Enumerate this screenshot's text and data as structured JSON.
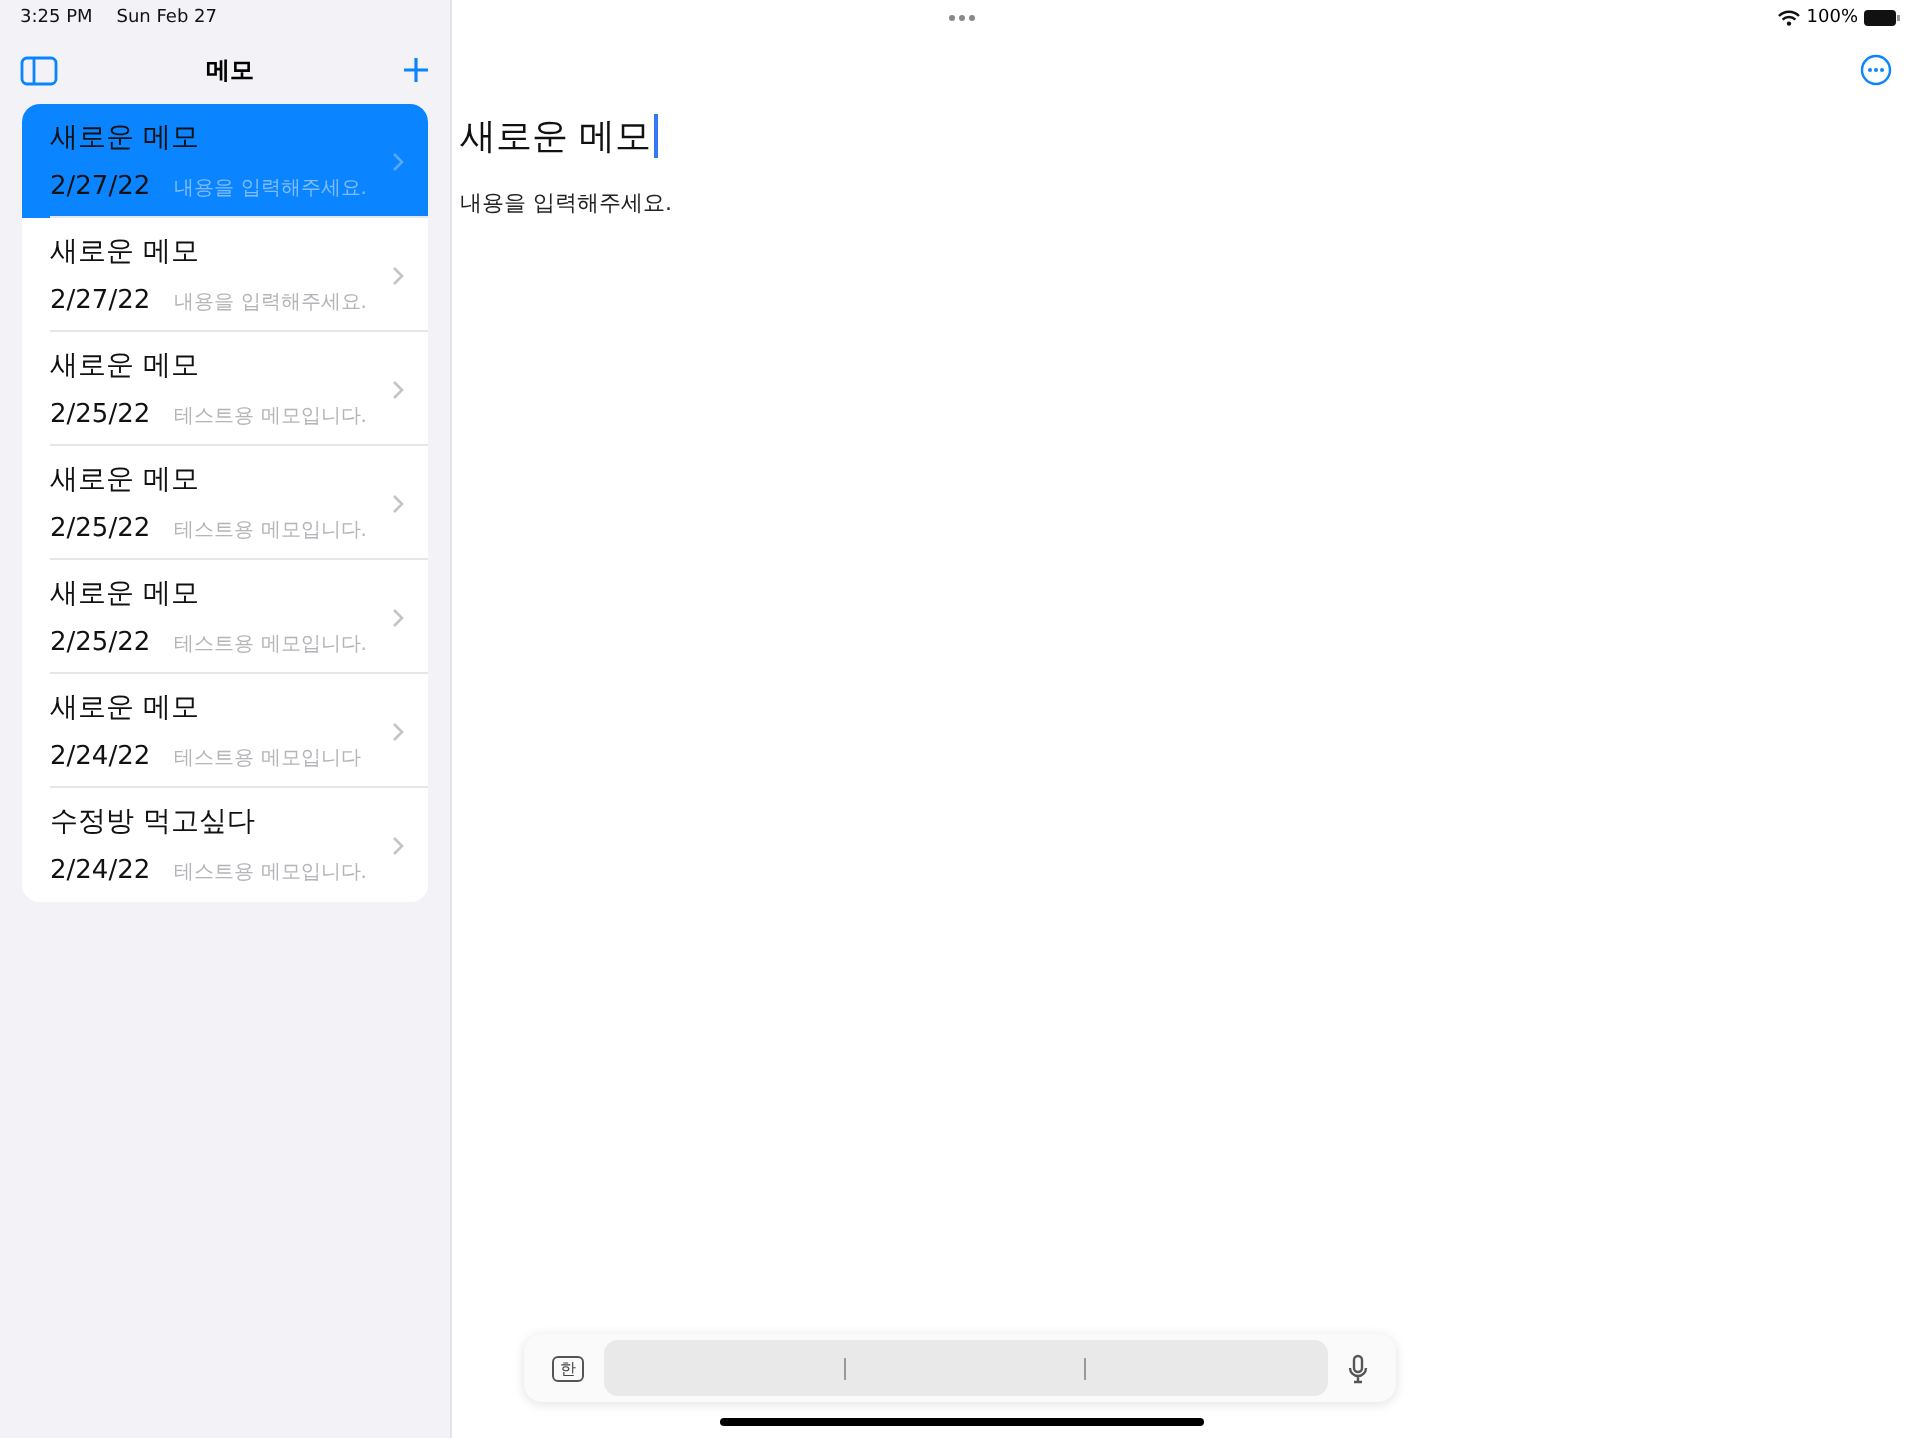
{
  "status_bar": {
    "time": "3:25 PM",
    "date": "Sun Feb 27",
    "battery": "100%"
  },
  "sidebar": {
    "title": "메모",
    "notes": [
      {
        "title": "새로운 메모",
        "date": "2/27/22",
        "preview": "내용을 입력해주세요.",
        "selected": true
      },
      {
        "title": "새로운 메모",
        "date": "2/27/22",
        "preview": "내용을 입력해주세요.",
        "selected": false
      },
      {
        "title": "새로운 메모",
        "date": "2/25/22",
        "preview": "테스트용 메모입니다.",
        "selected": false
      },
      {
        "title": "새로운 메모",
        "date": "2/25/22",
        "preview": "테스트용 메모입니다.",
        "selected": false
      },
      {
        "title": "새로운 메모",
        "date": "2/25/22",
        "preview": "테스트용 메모입니다.",
        "selected": false
      },
      {
        "title": "새로운 메모",
        "date": "2/24/22",
        "preview": "테스트용 메모입니다",
        "selected": false
      },
      {
        "title": "수정방 먹고싶다",
        "date": "2/24/22",
        "preview": "테스트용 메모입니다.",
        "selected": false
      }
    ]
  },
  "editor": {
    "title": "새로운 메모",
    "body": "내용을 입력해주세요."
  },
  "keyboard_bar": {
    "language_key": "한"
  }
}
